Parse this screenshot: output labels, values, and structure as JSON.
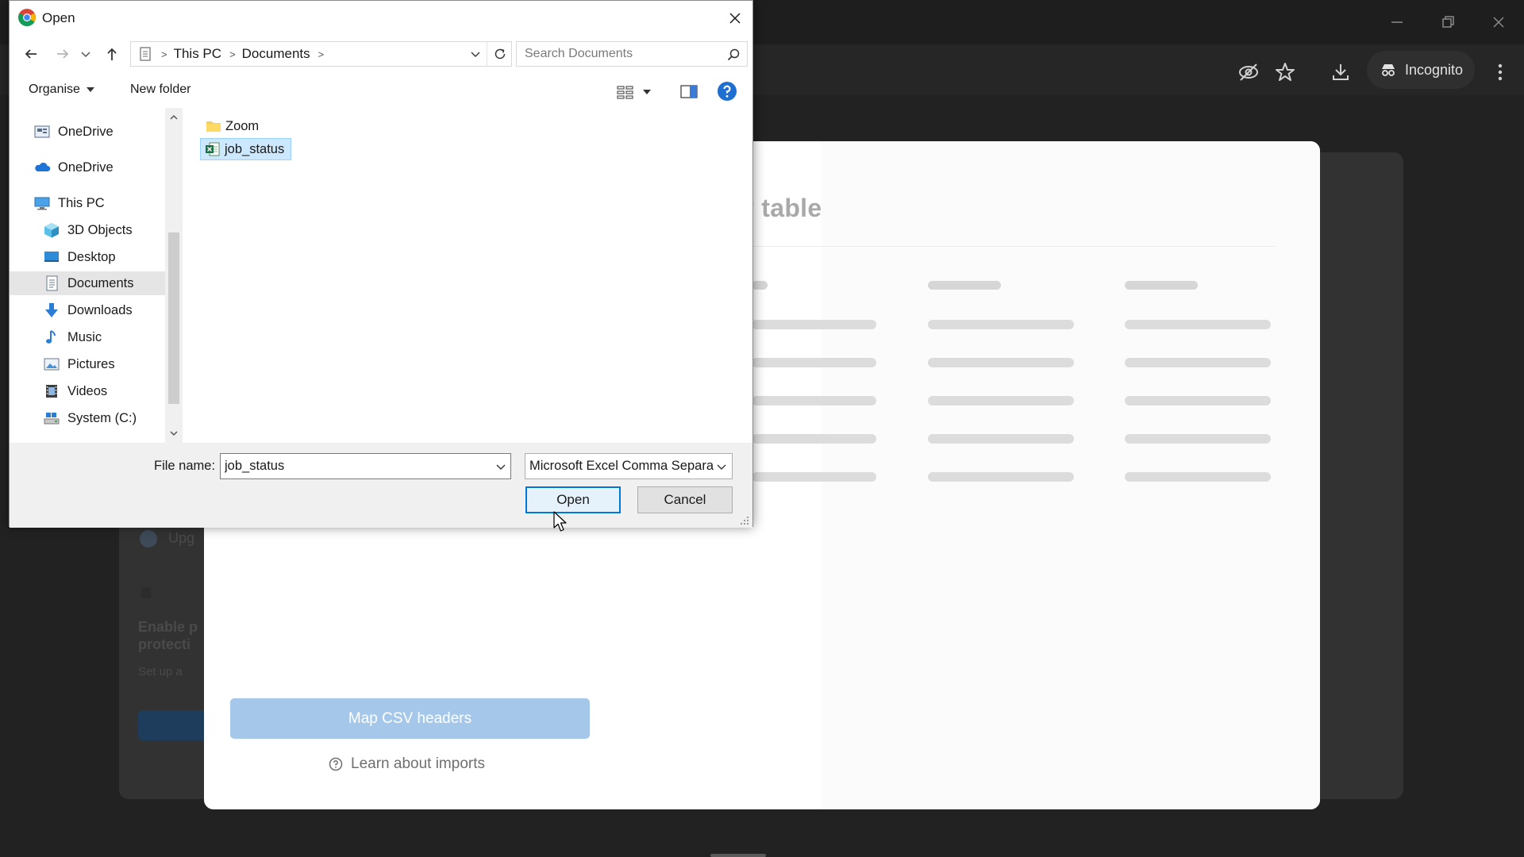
{
  "browser": {
    "incognito_label": "Incognito"
  },
  "background": {
    "upgrade_fragment": "Upg",
    "enable_fragment_1": "Enable p",
    "enable_fragment_2": "protecti",
    "setup_fragment": "Set up a"
  },
  "modal": {
    "title_fragment": "v table",
    "map_button_label": "Map CSV headers",
    "learn_link": "Learn about imports"
  },
  "dialog": {
    "title": "Open",
    "breadcrumb": [
      "This PC",
      "Documents"
    ],
    "search_placeholder": "Search Documents",
    "toolbar": {
      "organise_label": "Organise",
      "new_folder_label": "New folder"
    },
    "nav_items": [
      {
        "label": "OneDrive",
        "icon": "onedrive-business-icon"
      },
      {
        "label": "OneDrive",
        "icon": "onedrive-cloud-icon"
      },
      {
        "label": "This PC",
        "icon": "computer-icon"
      },
      {
        "label": "3D Objects",
        "icon": "cube-icon"
      },
      {
        "label": "Desktop",
        "icon": "desktop-icon"
      },
      {
        "label": "Documents",
        "icon": "documents-icon",
        "selected": true
      },
      {
        "label": "Downloads",
        "icon": "download-arrow-icon"
      },
      {
        "label": "Music",
        "icon": "music-note-icon"
      },
      {
        "label": "Pictures",
        "icon": "pictures-icon"
      },
      {
        "label": "Videos",
        "icon": "film-icon"
      },
      {
        "label": "System (C:)",
        "icon": "drive-icon"
      }
    ],
    "files": [
      {
        "name": "Zoom",
        "icon": "folder-icon"
      },
      {
        "name": "job_status",
        "icon": "excel-csv-icon",
        "selected": true
      }
    ],
    "file_name_label": "File name:",
    "file_name_value": "job_status",
    "file_type_value": "Microsoft Excel Comma Separa",
    "open_label": "Open",
    "cancel_label": "Cancel"
  },
  "colors": {
    "accent": "#0078d7",
    "selection": "#cce8ff",
    "map_button": "#a5c8ea"
  }
}
